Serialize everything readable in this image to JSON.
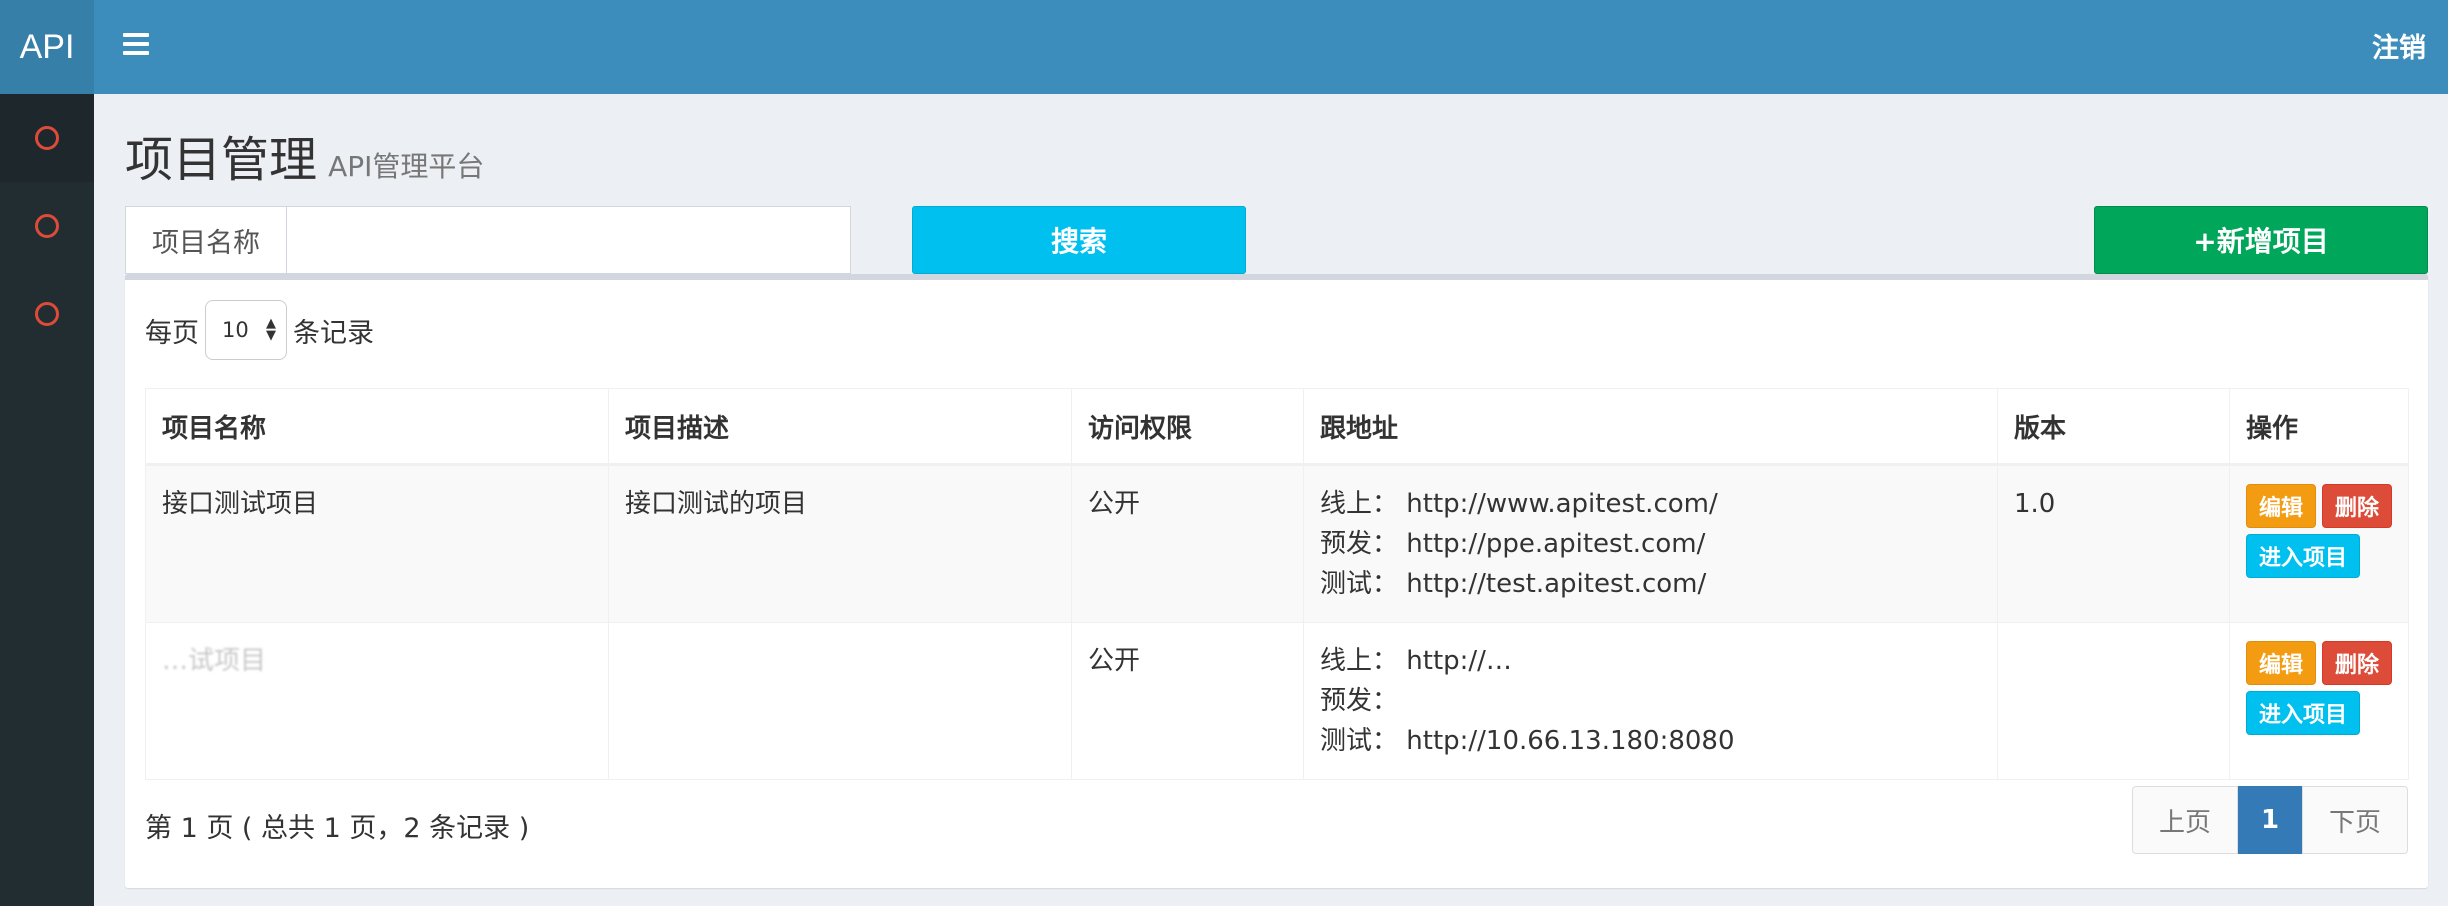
{
  "header": {
    "logo_text": "API",
    "logout_label": "注销"
  },
  "sidebar": {
    "items": [
      {
        "icon": "circle-o-icon"
      },
      {
        "icon": "circle-o-icon"
      },
      {
        "icon": "circle-o-icon"
      }
    ]
  },
  "page": {
    "title": "项目管理",
    "subtitle": "API管理平台"
  },
  "search": {
    "label": "项目名称",
    "value": "",
    "button_label": "搜索"
  },
  "add_button_label": "+新增项目",
  "perpage": {
    "prefix": "每页",
    "value": "10",
    "suffix": "条记录"
  },
  "table": {
    "columns": [
      "项目名称",
      "项目描述",
      "访问权限",
      "跟地址",
      "版本",
      "操作"
    ],
    "rows": [
      {
        "name": "接口测试项目",
        "description": "接口测试的项目",
        "access": "公开",
        "addresses": [
          "线上：  http://www.apitest.com/",
          "预发：  http://ppe.apitest.com/",
          "测试：  http://test.apitest.com/"
        ],
        "version": "1.0"
      },
      {
        "name": "…试项目",
        "description": "",
        "access": "公开",
        "addresses": [
          "线上：  http://…",
          "预发：",
          "测试：  http://10.66.13.180:8080"
        ],
        "version": ""
      }
    ],
    "actions": {
      "edit_label": "编辑",
      "delete_label": "删除",
      "enter_label": "进入项目"
    }
  },
  "pagination": {
    "info": "第 1 页 ( 总共 1 页，2 条记录 )",
    "prev_label": "上页",
    "current_page": "1",
    "next_label": "下页"
  },
  "colors": {
    "header": "#3c8dbc",
    "logo_bg": "#367fa9",
    "sidebar": "#222d32",
    "search_button": "#00c0ef",
    "add_button": "#00a65a",
    "edit_button": "#f39c12",
    "delete_button": "#dd4b39",
    "active_page": "#337ab7"
  }
}
